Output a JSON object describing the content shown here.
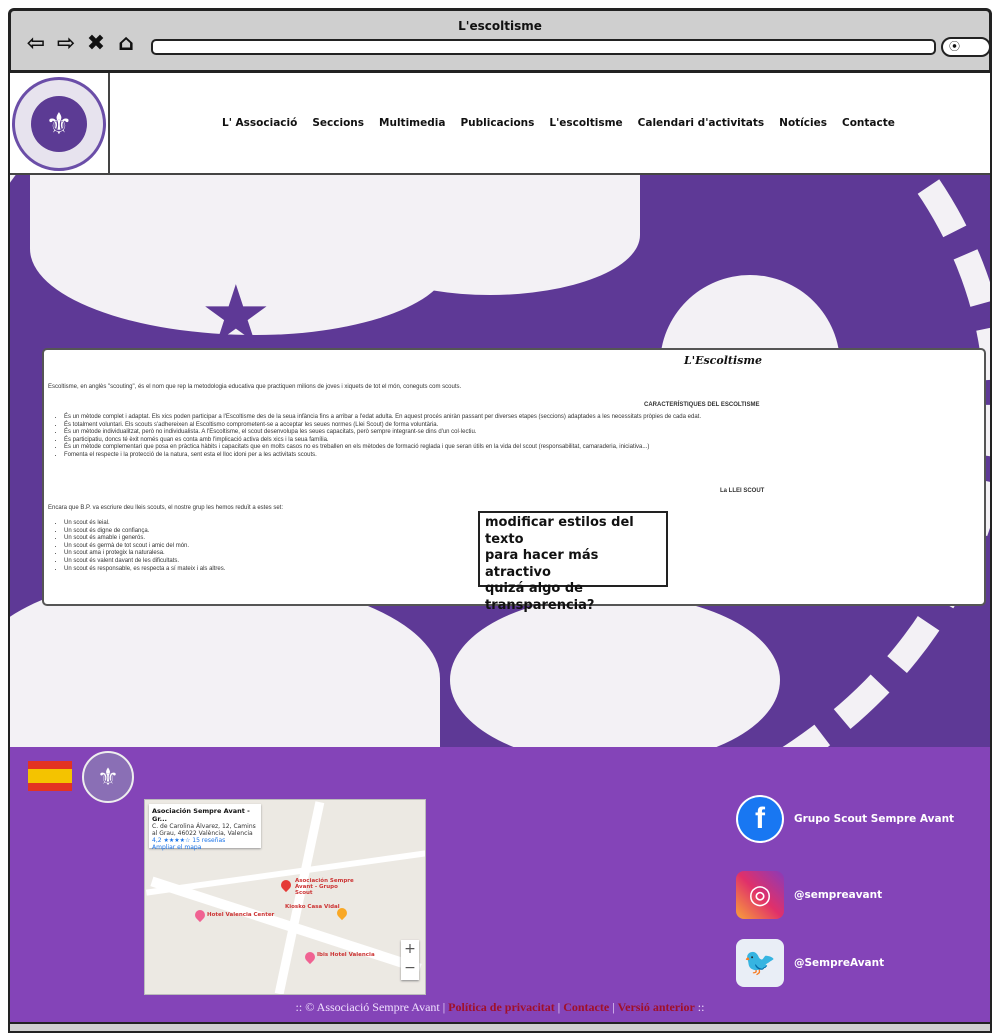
{
  "window": {
    "title": "L'escoltisme"
  },
  "browser": {
    "nav_glyphs": [
      "⇦",
      "⇨",
      "✖",
      "⌂"
    ],
    "search_glyph": "⦿"
  },
  "header": {
    "menu": [
      "L' Associació",
      "Seccions",
      "Multimedia",
      "Publicacions",
      "L'escoltisme",
      "Calendari d'activitats",
      "Notícies",
      "Contacte"
    ]
  },
  "content": {
    "title": "L'Escoltisme",
    "intro": "Escoltisme, en anglès \"scouting\", és el nom que rep la metodologia educativa que practiquen milions de joves i xiquets de tot el món, coneguts com scouts.",
    "subhead": "CARACTERÍSTIQUES DEL ESCOLTISME",
    "characteristics": [
      "És un mètode complet i adaptat. Els xics poden participar a l'Escoltisme des de la seua infància fins a arribar a l'edat adulta. En aquest procés aniràn passant per diverses etapes (seccions) adaptades a les necessitats pròpies de cada edat.",
      "És totalment voluntari. Els scouts s'adhereixen al Escoltismo comprometent-se a acceptar les seues normes (Llei Scout) de forma voluntària.",
      "És un mètode individualitzat, però no individualista. A l'Escoltisme, el scout desenvolupa les seues capacitats, però sempre integrant-se dins d'un col·lectiu.",
      "És participatiu, doncs té èxit només quan es conta amb l'implicació activa dels xics i la seua família.",
      "És un mètode complementari que posa en pràctica hàbits i capacitats que en molts casos no es treballen en els mètodes de formació reglada i que seran útils en la vida del scout (responsabilitat, camaraderia, iniciativa...)",
      "Fomenta el respecte i la protecció de la natura, sent esta el lloc idoni per a les activitats scouts."
    ],
    "subhead2": "La LLEI SCOUT",
    "intro2": "Encara que B.P. va escriure deu lleis scouts, el nostre grup les hemos reduït a estes set:",
    "laws": [
      "Un scout és leial.",
      "Un scout és digne de confiança.",
      "Un scout és amable i generós.",
      "Un scout és germà de tot scout i amic del món.",
      "Un scout ama i protegix la naturalesa.",
      "Un scout és valent davant de les dificultats.",
      "Un scout és responsable, es respecta a sí mateix i als altres."
    ]
  },
  "note": {
    "lines": [
      "modificar estilos del texto",
      "para hacer más atractivo",
      "quizá algo de",
      "transparencia?"
    ]
  },
  "map": {
    "place": "Asociación Sempre Avant - Gr...",
    "address": "C. de Carolina Álvarez, 12, Camins al Grau, 46022 València, Valencia",
    "rating": "4,2 ★★★★☆  15 reseñas",
    "link": "Ampliar el mapa",
    "labels": [
      "Asociación Sempre Avant - Grupo Scout",
      "Hotel Valencia Center",
      "Kiosko Casa Vidal",
      "Ibis Hotel Valencia"
    ],
    "zoom_in": "+",
    "zoom_out": "−"
  },
  "footer": {
    "social": [
      {
        "icon": "facebook-icon",
        "glyph": "f",
        "label": "Grupo Scout Sempre Avant"
      },
      {
        "icon": "instagram-icon",
        "glyph": "◎",
        "label": "@sempreavant"
      },
      {
        "icon": "twitter-icon",
        "glyph": "🐦",
        "label": "@SempreAvant"
      }
    ],
    "copyright": ":: © Associació Sempre Avant",
    "links": [
      "Política de privacitat",
      "Contacte",
      "Versió anterior"
    ],
    "trail": "::"
  }
}
